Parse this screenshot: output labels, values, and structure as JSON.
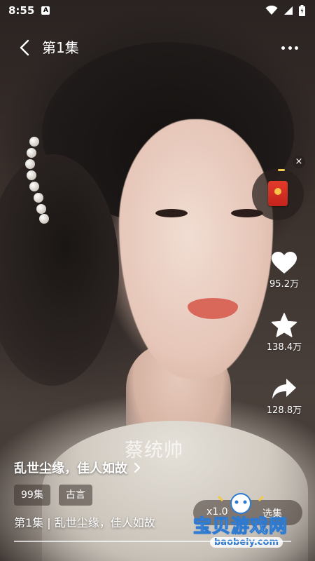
{
  "status_bar": {
    "time": "8:55",
    "notification_icon": "A"
  },
  "top_bar": {
    "title": "第1集"
  },
  "side_actions": {
    "like_count": "95.2万",
    "favorite_count": "138.4万",
    "share_count": "128.8万"
  },
  "video": {
    "watermark_name": "蔡统帅",
    "series_title": "乱世尘缘，佳人如故",
    "tags": [
      "99集",
      "古言"
    ],
    "episode_desc": "第1集 | 乱世尘缘，佳人如故",
    "progress": 1.0
  },
  "controls": {
    "speed": "x1.0",
    "episodes": "选集"
  },
  "watermark_brand": {
    "text": "宝贝游戏网",
    "url": "baobeiy.com"
  },
  "colors": {
    "brand_blue": "#2e7ad1",
    "red_packet": "#e23b2b"
  },
  "icons": [
    "back-icon",
    "more-icon",
    "heart-icon",
    "star-icon",
    "share-icon",
    "red-packet-icon",
    "close-icon",
    "wifi-icon",
    "signal-icon",
    "battery-icon"
  ]
}
